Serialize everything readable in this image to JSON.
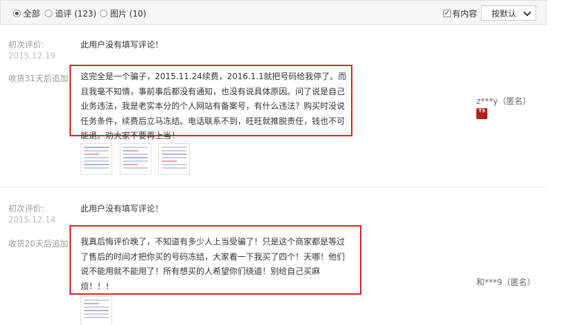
{
  "filter": {
    "options": [
      "全部",
      "追评 (123)",
      "图片 (10)"
    ],
    "selected_index": 0,
    "has_content_label": "有内容",
    "has_content_checked": true,
    "sort_label": "按默认"
  },
  "reviews": [
    {
      "initial_label": "初次评价:",
      "initial_date": "2015.12.19",
      "initial_text": "此用户没有填写评论！",
      "append_label": "收货31天后追加：",
      "append_lines": [
        "这完全是一个骗子，2015.11.24续费，2016.1.1就把号码给我停了。而",
        "且我毫不知情，事前事后都没有通知，也没有说具体原因。问了说是自己",
        "业务违法，我是老实本分的个人网站有备案号，有什么违法？购买时没说",
        "任务条件，续费后立马冻结。电话联系不到，旺旺就推脱责任，钱也不可",
        "能退。劝大家不要再上当！"
      ],
      "user": "z***y（匿名）",
      "badge": "T3",
      "image_count": 3
    },
    {
      "initial_label": "初次评价:",
      "initial_date": "2015.12.14",
      "initial_text": "此用户没有填写评论！",
      "append_label": "收货20天后追加：",
      "append_lines": [
        "我真后悔评价晚了，不知道有多少人上当受骗了！只是这个商家都是等过",
        "了售后的时间才把你买的号码冻结，大家看一下我买了四个！天哪！他们",
        "说不能用就不能用了！所有想买的人希望你们绕道！别给自己买麻",
        "烦！！！"
      ],
      "user": "和***9（匿名）",
      "image_count": 1
    }
  ],
  "colors": {
    "highlight_box": "#e02020",
    "label": "#999999",
    "date": "#bbbbbb"
  }
}
